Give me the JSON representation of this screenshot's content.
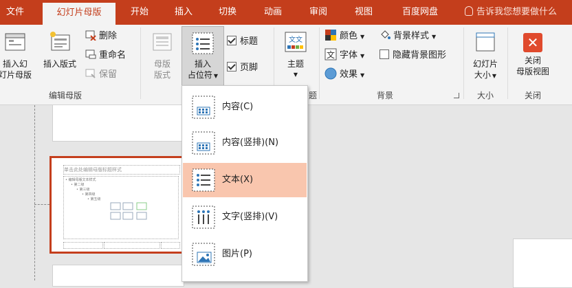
{
  "tabs": {
    "file": "文件",
    "slide_master": "幻灯片母版",
    "home": "开始",
    "insert": "插入",
    "transitions": "切换",
    "animations": "动画",
    "review": "审阅",
    "view": "视图",
    "baidu": "百度网盘",
    "tell_me": "告诉我您想要做什么"
  },
  "edit_master": {
    "insert_master_line1": "插入幻",
    "insert_master_line2": "灯片母版",
    "insert_layout": "插入版式",
    "delete": "删除",
    "rename": "重命名",
    "preserve": "保留",
    "group": "编辑母版"
  },
  "master_layout": {
    "layout_line1": "母版",
    "layout_line2": "版式",
    "insert_placeholder_line1": "插入",
    "insert_placeholder_line2": "占位符",
    "title": "标题",
    "footer": "页脚"
  },
  "theme": {
    "label": "主题",
    "group_suffix": "题"
  },
  "background": {
    "colors": "颜色",
    "fonts": "字体",
    "effects": "效果",
    "bg_styles": "背景样式",
    "hide_bg": "隐藏背景图形",
    "group": "背景"
  },
  "size": {
    "slide_size_line1": "幻灯片",
    "slide_size_line2": "大小",
    "group": "大小"
  },
  "close": {
    "close_line1": "关闭",
    "close_line2": "母版视图",
    "group": "关闭"
  },
  "placeholder_menu": {
    "items": [
      "内容(C)",
      "内容(竖排)(N)",
      "文本(X)",
      "文字(竖排)(V)",
      "图片(P)"
    ]
  },
  "thumbnail": {
    "title_text": "单击此处编辑母版标题样式",
    "body_text": "• 编辑母版文本样式",
    "level2": "• 第二级",
    "level3": "• 第三级",
    "level4": "• 第四级",
    "level5": "• 第五级"
  },
  "colors": {
    "accent": "#c43e1c",
    "ribbon": "#f3f3f3",
    "hover": "#f9c6ae"
  }
}
